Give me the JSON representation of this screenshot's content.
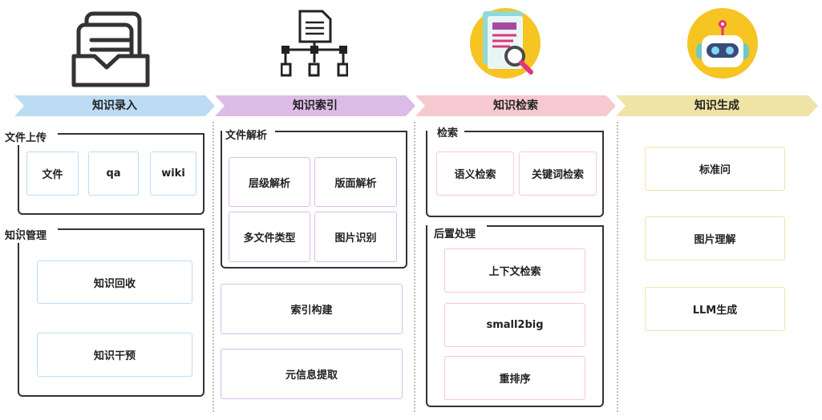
{
  "colors": {
    "blue": "#bcdcf3",
    "purple": "#dcbce6",
    "pink": "#f6c9d0",
    "yellow": "#f0e3a6",
    "frame": "#333333"
  },
  "icons": [
    "inbox-document-icon",
    "document-hierarchy-icon",
    "document-search-icon",
    "robot-icon"
  ],
  "stages": [
    {
      "title": "知识录入",
      "groups": [
        {
          "title": "文件上传",
          "items": [
            "文件",
            "qa",
            "wiki"
          ]
        },
        {
          "title": "知识管理",
          "items": [
            "知识回收",
            "知识干预"
          ]
        }
      ]
    },
    {
      "title": "知识索引",
      "groups": [
        {
          "title": "文件解析",
          "items": [
            "层级解析",
            "版面解析",
            "多文件类型",
            "图片识别"
          ]
        }
      ],
      "items": [
        "索引构建",
        "元信息提取"
      ]
    },
    {
      "title": "知识检索",
      "groups": [
        {
          "title": "检索",
          "items": [
            "语义检索",
            "关键词检索"
          ]
        },
        {
          "title": "后置处理",
          "items": [
            "上下文检索",
            "small2big",
            "重排序"
          ]
        }
      ]
    },
    {
      "title": "知识生成",
      "items": [
        "标准问",
        "图片理解",
        "LLM生成"
      ]
    }
  ]
}
